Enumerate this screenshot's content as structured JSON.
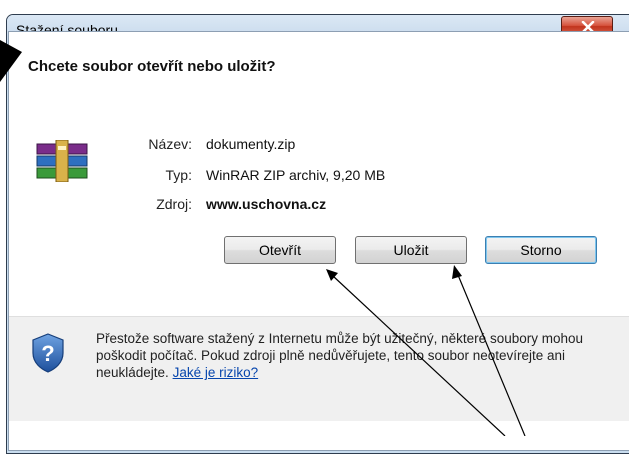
{
  "dialog": {
    "title": "Stažení souboru",
    "question": "Chcete soubor otevřít nebo uložit?",
    "fields": {
      "name_label": "Název:",
      "name_value": "dokumenty.zip",
      "type_label": "Typ:",
      "type_value": "WinRAR ZIP archiv, 9,20 MB",
      "source_label": "Zdroj:",
      "source_value": "www.uschovna.cz"
    },
    "buttons": {
      "open": "Otevřít",
      "save": "Uložit",
      "cancel": "Storno"
    },
    "warning": {
      "text": "Přestože software stažený z Internetu může být užitečný, některé soubory mohou poškodit počítač. Pokud zdroji plně nedůvěřujete, tento soubor neotevírejte ani neukládejte.",
      "link": "Jaké je riziko?"
    },
    "close_icon": "close-x-icon",
    "file_icon": "winrar-archive-icon",
    "shield_icon": "security-shield-question-icon"
  }
}
